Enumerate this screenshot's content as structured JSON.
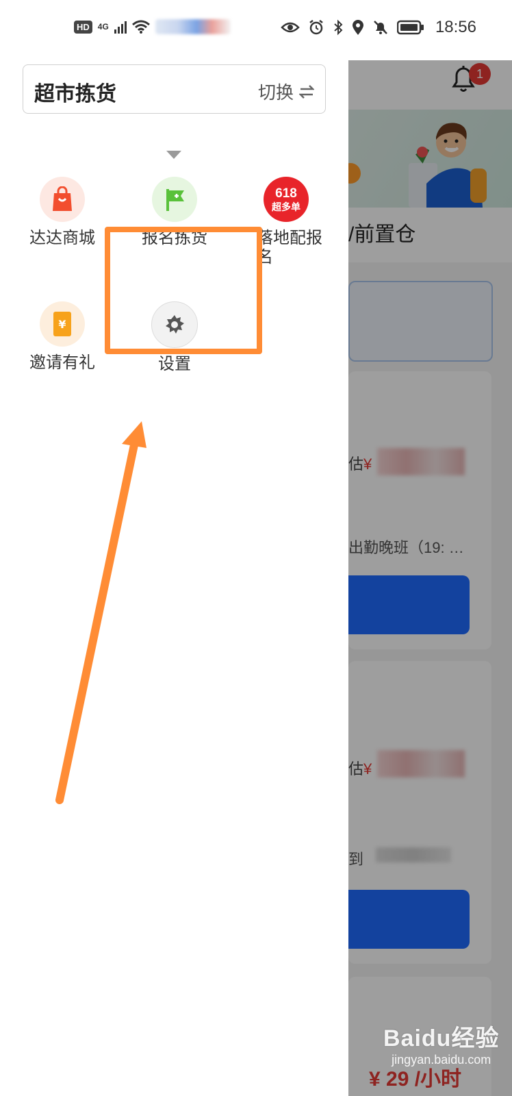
{
  "status_bar": {
    "hd": "HD",
    "network": "4G",
    "time": "18:56",
    "icons": [
      "eye-icon",
      "alarm-icon",
      "bluetooth-icon",
      "location-icon",
      "mute-bell-icon",
      "battery-icon"
    ]
  },
  "drawer": {
    "current_mode": "超市拣货",
    "switch_label": "切换",
    "menu_items": [
      {
        "label": "达达商城",
        "icon": "shopping-bag-icon"
      },
      {
        "label": "报名拣货",
        "icon": "signup-flag-icon"
      },
      {
        "label": "落地配报名",
        "icon": "618-badge-icon",
        "badge_text": "618",
        "badge_sub": "超多单"
      },
      {
        "label": "邀请有礼",
        "icon": "gift-coupon-icon"
      },
      {
        "label": "设置",
        "icon": "gear-icon"
      }
    ]
  },
  "background_app": {
    "notification_count": "1",
    "section_title": "/前置仓",
    "card1": {
      "estimate_prefix": "估",
      "currency": "¥",
      "shift": "出勤晚班（19: …"
    },
    "card2": {
      "estimate_prefix": "估",
      "currency": "¥",
      "arrive": "到"
    },
    "bottom_price": "¥ 29 /小时"
  },
  "watermark": {
    "main": "Baidu经验",
    "sub": "jingyan.baidu.com"
  },
  "colors": {
    "highlight": "#ff8c35",
    "primary_blue": "#1f6bff",
    "badge_red": "#e53935"
  }
}
